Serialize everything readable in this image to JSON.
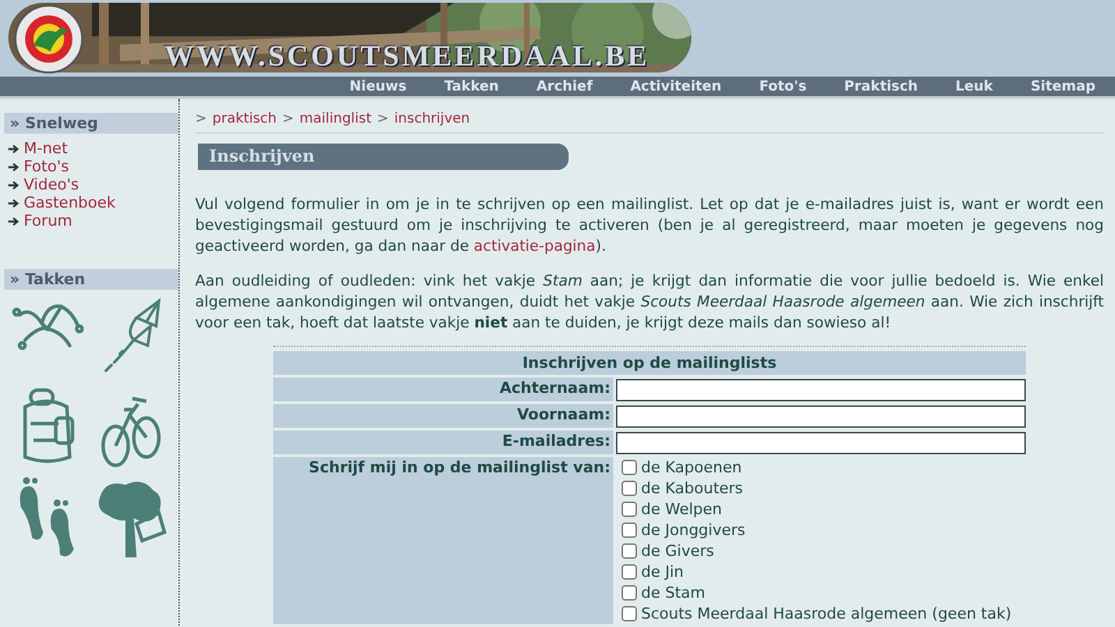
{
  "header": {
    "site_title": "WWW.SCOUTSMEERDAAL.BE"
  },
  "nav": [
    {
      "label": "Nieuws"
    },
    {
      "label": "Takken"
    },
    {
      "label": "Archief"
    },
    {
      "label": "Activiteiten"
    },
    {
      "label": "Foto's"
    },
    {
      "label": "Praktisch"
    },
    {
      "label": "Leuk"
    },
    {
      "label": "Sitemap"
    }
  ],
  "sidebar": {
    "sections": [
      {
        "kind": "links",
        "marker": "»",
        "title": "Snelweg",
        "links": [
          "M-net",
          "Foto's",
          "Video's",
          "Gastenboek",
          "Forum"
        ]
      },
      {
        "kind": "drawings",
        "marker": "»",
        "title": "Takken"
      }
    ]
  },
  "breadcrumb": {
    "separator": ">",
    "items": [
      "praktisch",
      "mailinglist",
      "inschrijven"
    ]
  },
  "heading": "Inschrijven",
  "paragraphs": [
    {
      "text": "Vul volgend formulier in om je in te schrijven op een mailinglist. Let op dat je e-mailadres juist is, want er wordt een bevestigingsmail gestuurd om je inschrijving te activeren (ben je al geregistreerd, maar moeten je gegevens nog geactiveerd worden, ga dan naar de ",
      "link": "activatie-pagina",
      "after": ")."
    },
    {
      "text": "Aan oudleiding of oudleden: vink het vakje *Stam* aan; je krijgt dan informatie die voor jullie bedoeld is. Wie enkel algemene aankondigingen wil ontvangen, duidt het vakje *Scouts Meerdaal Haasrode algemeen* aan. Wie zich inschrijft voor een tak, hoeft dat laatste vakje **niet** aan te duiden, je krijgt deze mails dan sowieso al!"
    }
  ],
  "form": {
    "title": "Inschrijven op de mailinglists",
    "fields": [
      {
        "label": "Achternaam:"
      },
      {
        "label": "Voornaam:"
      },
      {
        "label": "E-mailadres:"
      }
    ],
    "list_label": "Schrijf mij in op de mailinglist van:",
    "options": [
      {
        "label": "de Kapoenen",
        "checked": false
      },
      {
        "label": "de Kabouters",
        "checked": false
      },
      {
        "label": "de Welpen",
        "checked": false
      },
      {
        "label": "de Jonggivers",
        "checked": false
      },
      {
        "label": "de Givers",
        "checked": false
      },
      {
        "label": "de Jin",
        "checked": false
      },
      {
        "label": "de Stam",
        "checked": false
      },
      {
        "label": "Scouts Meerdaal Haasrode algemeen (geen tak)",
        "checked": false
      }
    ]
  }
}
